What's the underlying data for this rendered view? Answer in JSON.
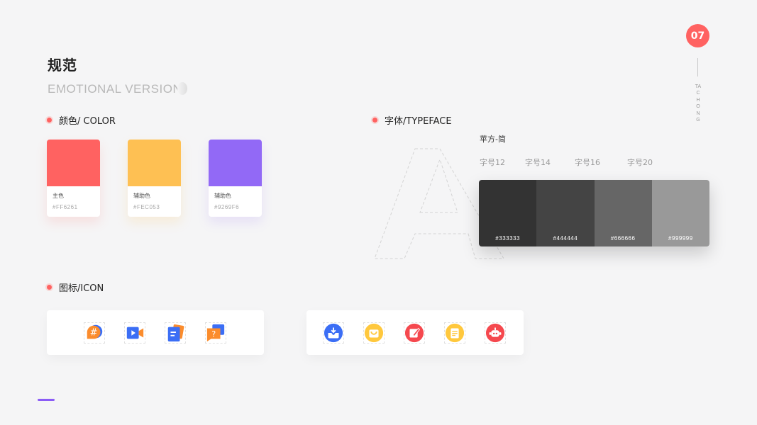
{
  "header": {
    "title": "规范",
    "subtitle": "EMOTIONAL VERSION",
    "page_number": "07",
    "brand_vertical": "TACHONG"
  },
  "color_section": {
    "heading": "颜色/ COLOR",
    "swatches": [
      {
        "name": "主色",
        "hex": "#FF6261",
        "color": "#FF6261"
      },
      {
        "name": "辅助色",
        "hex": "#FEC053",
        "color": "#FEC053"
      },
      {
        "name": "辅助色",
        "hex": "#9269F6",
        "color": "#9269F6"
      }
    ]
  },
  "typeface_section": {
    "heading": "字体/TYPEFACE",
    "font_name": "苹方-简",
    "sizes": [
      "字号12",
      "字号14",
      "字号16",
      "字号20"
    ],
    "grays": [
      {
        "hex": "#333333",
        "color": "#333333"
      },
      {
        "hex": "#444444",
        "color": "#444444"
      },
      {
        "hex": "#666666",
        "color": "#666666"
      },
      {
        "hex": "#999999",
        "color": "#999999"
      }
    ]
  },
  "icon_section": {
    "heading": "图标/ICON",
    "panel1_icons": [
      "hashtag-chat-icon",
      "video-camera-icon",
      "document-icon",
      "question-chat-icon"
    ],
    "panel2_icons": [
      "inbox-icon",
      "shopping-bag-icon",
      "edit-icon",
      "clipboard-icon",
      "robot-icon"
    ],
    "hashtag_glyph": "#",
    "question_glyph": "?"
  },
  "colors": {
    "accent": "#FF6261",
    "secondary_purple": "#8B5CF6"
  }
}
